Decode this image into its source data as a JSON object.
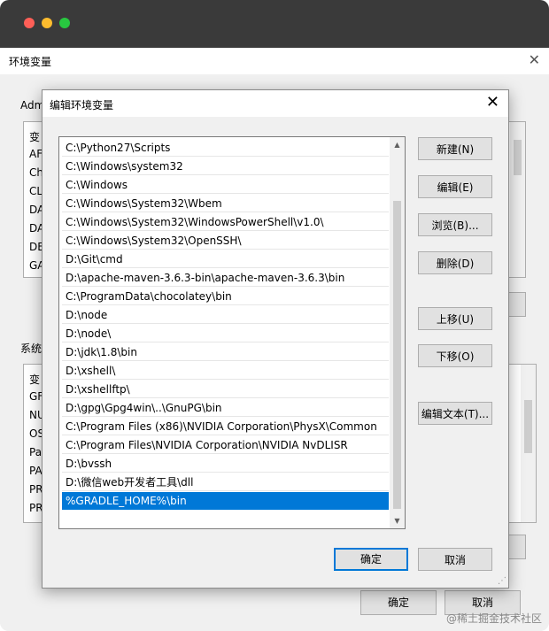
{
  "background_window": {
    "title": "环境变量",
    "user_group_label": "Adm",
    "user_list_letters": [
      "变",
      "AF",
      "Ch",
      "CL",
      "DA",
      "DA",
      "DE",
      "GA"
    ],
    "system_group_label": "系统",
    "system_list_letters": [
      "变",
      "GF",
      "NU",
      "OS",
      "Pa",
      "PA",
      "PR",
      "PR"
    ],
    "ok_label": "确定",
    "cancel_label": "取消"
  },
  "dialog": {
    "title": "编辑环境变量",
    "paths": [
      "C:\\Python27\\Scripts",
      "C:\\Windows\\system32",
      "C:\\Windows",
      "C:\\Windows\\System32\\Wbem",
      "C:\\Windows\\System32\\WindowsPowerShell\\v1.0\\",
      "C:\\Windows\\System32\\OpenSSH\\",
      "D:\\Git\\cmd",
      "D:\\apache-maven-3.6.3-bin\\apache-maven-3.6.3\\bin",
      "C:\\ProgramData\\chocolatey\\bin",
      "D:\\node",
      "D:\\node\\",
      "D:\\jdk\\1.8\\bin",
      "D:\\xshell\\",
      "D:\\xshellftp\\",
      "D:\\gpg\\Gpg4win\\..\\GnuPG\\bin",
      "C:\\Program Files (x86)\\NVIDIA Corporation\\PhysX\\Common",
      "C:\\Program Files\\NVIDIA Corporation\\NVIDIA NvDLISR",
      "D:\\bvssh",
      "D:\\微信web开发者工具\\dll",
      "%GRADLE_HOME%\\bin"
    ],
    "selected_index": 19,
    "buttons": {
      "new": "新建(N)",
      "edit": "编辑(E)",
      "browse": "浏览(B)...",
      "delete": "删除(D)",
      "move_up": "上移(U)",
      "move_down": "下移(O)",
      "edit_text": "编辑文本(T)...",
      "ok": "确定",
      "cancel": "取消"
    }
  },
  "watermark": "@稀土掘金技术社区",
  "colors": {
    "selection": "#0078d7",
    "titlebar": "#3a3a3a"
  }
}
